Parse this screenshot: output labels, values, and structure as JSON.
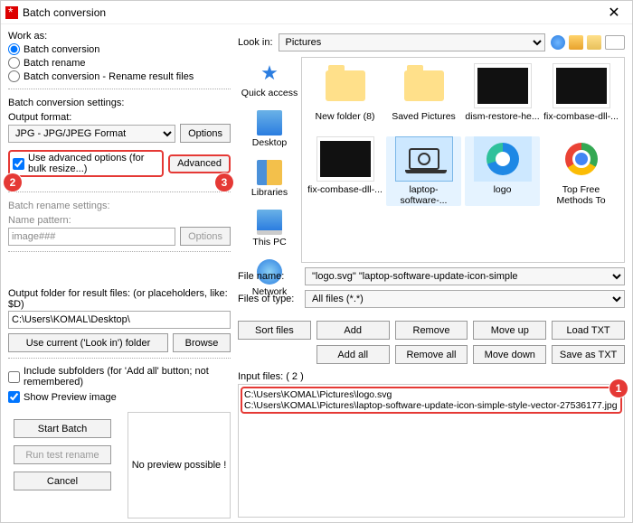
{
  "window": {
    "title": "Batch conversion",
    "close": "✕"
  },
  "work_as": {
    "label": "Work as:",
    "options": [
      {
        "label": "Batch conversion",
        "checked": true
      },
      {
        "label": "Batch rename",
        "checked": false
      },
      {
        "label": "Batch conversion - Rename result files",
        "checked": false
      }
    ]
  },
  "batch_settings": {
    "heading": "Batch conversion settings:",
    "output_format_label": "Output format:",
    "output_format_value": "JPG - JPG/JPEG Format",
    "options_btn": "Options",
    "use_advanced_label": "Use advanced options (for bulk resize...)",
    "use_advanced_checked": true,
    "advanced_btn": "Advanced"
  },
  "rename_settings": {
    "heading": "Batch rename settings:",
    "name_pattern_label": "Name pattern:",
    "name_pattern_value": "image###",
    "options_btn": "Options"
  },
  "output_folder": {
    "label": "Output folder for result files: (or placeholders, like: $D)",
    "path": "C:\\Users\\KOMAL\\Desktop\\",
    "use_current_btn": "Use current ('Look in') folder",
    "browse_btn": "Browse"
  },
  "bottom_opts": {
    "include_subfolders_label": "Include subfolders (for 'Add all' button; not remembered)",
    "include_subfolders_checked": false,
    "show_preview_label": "Show Preview image",
    "show_preview_checked": true
  },
  "action_btns": {
    "start": "Start Batch",
    "run_test": "Run test rename",
    "cancel": "Cancel"
  },
  "preview": {
    "text": "No preview possible !"
  },
  "lookin": {
    "label": "Look in:",
    "value": "Pictures"
  },
  "places": [
    "Quick access",
    "Desktop",
    "Libraries",
    "This PC",
    "Network"
  ],
  "files": [
    {
      "name": "New folder (8)",
      "kind": "folder",
      "sel": false
    },
    {
      "name": "Saved Pictures",
      "kind": "folder",
      "sel": false
    },
    {
      "name": "dism-restore-he...",
      "kind": "black",
      "sel": false
    },
    {
      "name": "fix-combase-dll-...",
      "kind": "black",
      "sel": false
    },
    {
      "name": "fix-combase-dll-...",
      "kind": "black",
      "sel": false
    },
    {
      "name": "laptop-software-...",
      "kind": "laptop",
      "sel": true
    },
    {
      "name": "logo",
      "kind": "edge",
      "sel": true
    },
    {
      "name": "Top Free Methods To Convert PST ...",
      "kind": "chrome",
      "sel": false
    }
  ],
  "file_name": {
    "label": "File name:",
    "value": "\"logo.svg\" \"laptop-software-update-icon-simple"
  },
  "file_type": {
    "label": "Files of type:",
    "value": "All files (*.*)"
  },
  "list_actions": {
    "sort": "Sort files",
    "add": "Add",
    "remove": "Remove",
    "moveup": "Move up",
    "loadtxt": "Load TXT",
    "addall": "Add all",
    "removeall": "Remove all",
    "movedown": "Move down",
    "savetxt": "Save as TXT"
  },
  "input_files": {
    "label": "Input files: ( 2 )",
    "items": [
      "C:\\Users\\KOMAL\\Pictures\\logo.svg",
      "C:\\Users\\KOMAL\\Pictures\\laptop-software-update-icon-simple-style-vector-27536177.jpg"
    ]
  },
  "annot": {
    "b1": "1",
    "b2": "2",
    "b3": "3"
  }
}
